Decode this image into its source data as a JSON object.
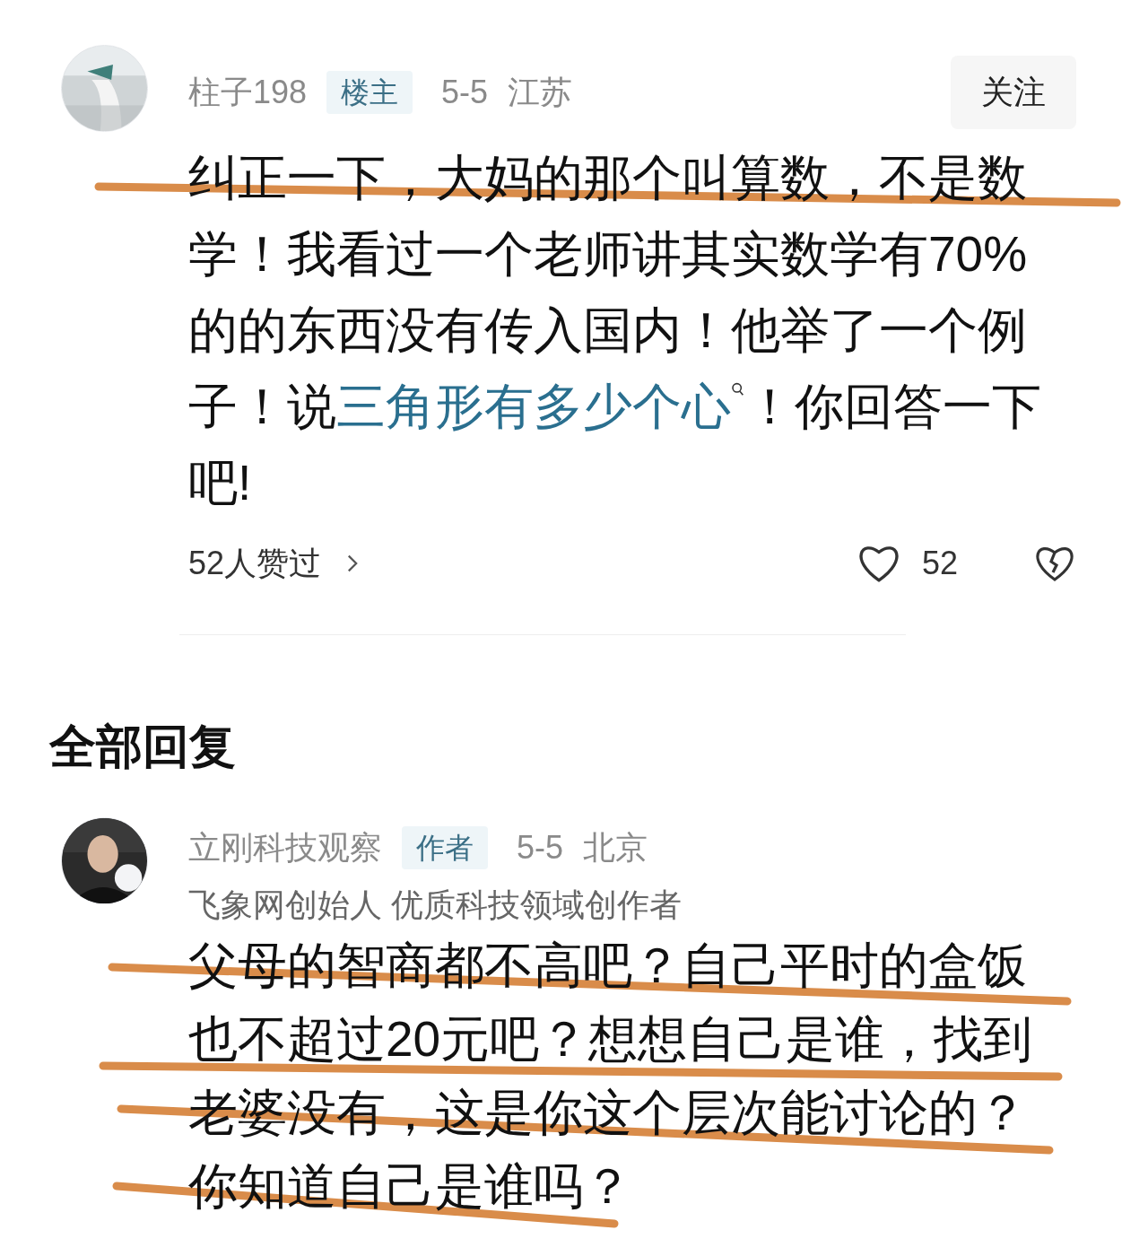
{
  "post": {
    "author": "柱子198",
    "badge": "楼主",
    "date": "5-5",
    "location": "江苏",
    "follow": "关注",
    "hand_underlined": true,
    "body": [
      {
        "kind": "plain",
        "text": "纠正一下，大妈的那个叫算数，不是数学！我看过一个老师讲其实数学有70%的的东西没有传入国内！他举了一个例子！说"
      },
      {
        "kind": "link",
        "text": "三角形有多少个心"
      },
      {
        "kind": "plain",
        "text": "！你回答一下吧!"
      }
    ],
    "likers": "52人赞过",
    "likes": "52"
  },
  "replies_heading": "全部回复",
  "reply": {
    "author": "立刚科技观察",
    "badge": "作者",
    "date": "5-5",
    "location": "北京",
    "subtitle": "飞象网创始人 优质科技领域创作者",
    "hand_underlined": true,
    "body": [
      {
        "kind": "plain",
        "text": "父母的智商都不高吧？自己平时的盒饭也不超过20元吧？想想自己是谁，找到老婆没有，这是你这个层次能讨论的？你知道自己是谁吗？"
      }
    ]
  }
}
